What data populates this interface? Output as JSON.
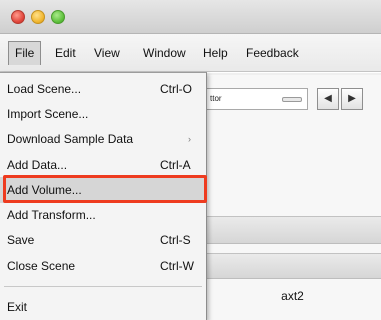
{
  "window": {
    "buttons": [
      "close-button",
      "minimize-button",
      "zoom-button"
    ]
  },
  "menubar": {
    "items": [
      {
        "label": "File"
      },
      {
        "label": "Edit"
      },
      {
        "label": "View"
      },
      {
        "label": "Window"
      },
      {
        "label": "Help"
      },
      {
        "label": "Feedback"
      }
    ]
  },
  "toolbar": {
    "combo_value": "ttor",
    "prev_icon": "◀",
    "next_icon": "▶"
  },
  "panel": {
    "row_label": "axt2"
  },
  "file_menu": {
    "items": [
      {
        "label": "Load Scene...",
        "shortcut": "Ctrl-O"
      },
      {
        "label": "Import Scene...",
        "shortcut": ""
      },
      {
        "label": "Download Sample Data",
        "shortcut": "",
        "submenu": "›"
      },
      {
        "label": "Add Data...",
        "shortcut": "Ctrl-A"
      },
      {
        "label": "Add Volume...",
        "shortcut": ""
      },
      {
        "label": "Add Transform...",
        "shortcut": ""
      },
      {
        "label": "Save",
        "shortcut": "Ctrl-S"
      },
      {
        "label": "Close Scene",
        "shortcut": "Ctrl-W"
      },
      {
        "label": "Exit",
        "shortcut": ""
      }
    ],
    "highlighted_item": "Add Volume...",
    "highlight_color": "#ee3b1f"
  }
}
